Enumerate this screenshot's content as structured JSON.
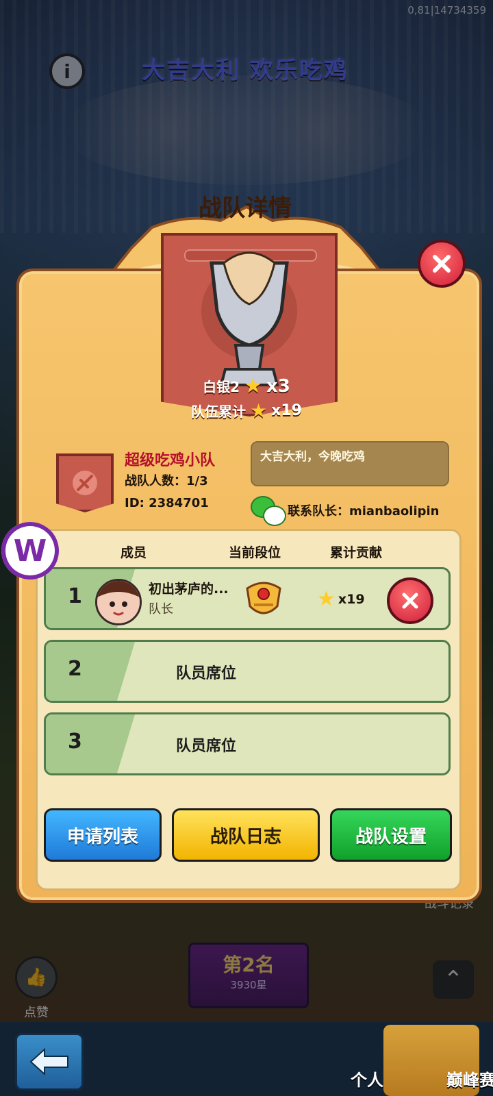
{
  "status": {
    "corner_text": "0,81|14734359"
  },
  "background": {
    "event_title": "大吉大利 欢乐吃鸡",
    "like_label": "点赞",
    "rank_title": "第2名",
    "rank_stars": "3930星",
    "battle_record_label": "战斗记录"
  },
  "bottom_nav": {
    "tab1_label": "个人吃鸡",
    "tab2_label": "巅峰赛事"
  },
  "modal": {
    "title": "战队详情",
    "tier_name": "白银2",
    "tier_multiplier": "x3",
    "team_total_label": "队伍累计",
    "team_total_multiplier": "x19",
    "team_name": "超级吃鸡小队",
    "team_members_text": "战队人数：1/3",
    "team_id_text": "ID: 2384701",
    "motto": "大吉大利，今晚吃鸡",
    "contact_text": "联系队长：mianbaolipin",
    "headers": {
      "member": "成员",
      "rank": "当前段位",
      "contribution": "累计贡献"
    },
    "rows": [
      {
        "index": "1",
        "name": "初出茅庐的...",
        "role": "队长",
        "contribution": "x19"
      },
      {
        "index": "2",
        "seat": "队员席位"
      },
      {
        "index": "3",
        "seat": "队员席位"
      }
    ],
    "buttons": {
      "apply_list": "申请列表",
      "team_log": "战队日志",
      "team_settings": "战队设置"
    }
  },
  "watermark": {
    "letter": "W"
  }
}
